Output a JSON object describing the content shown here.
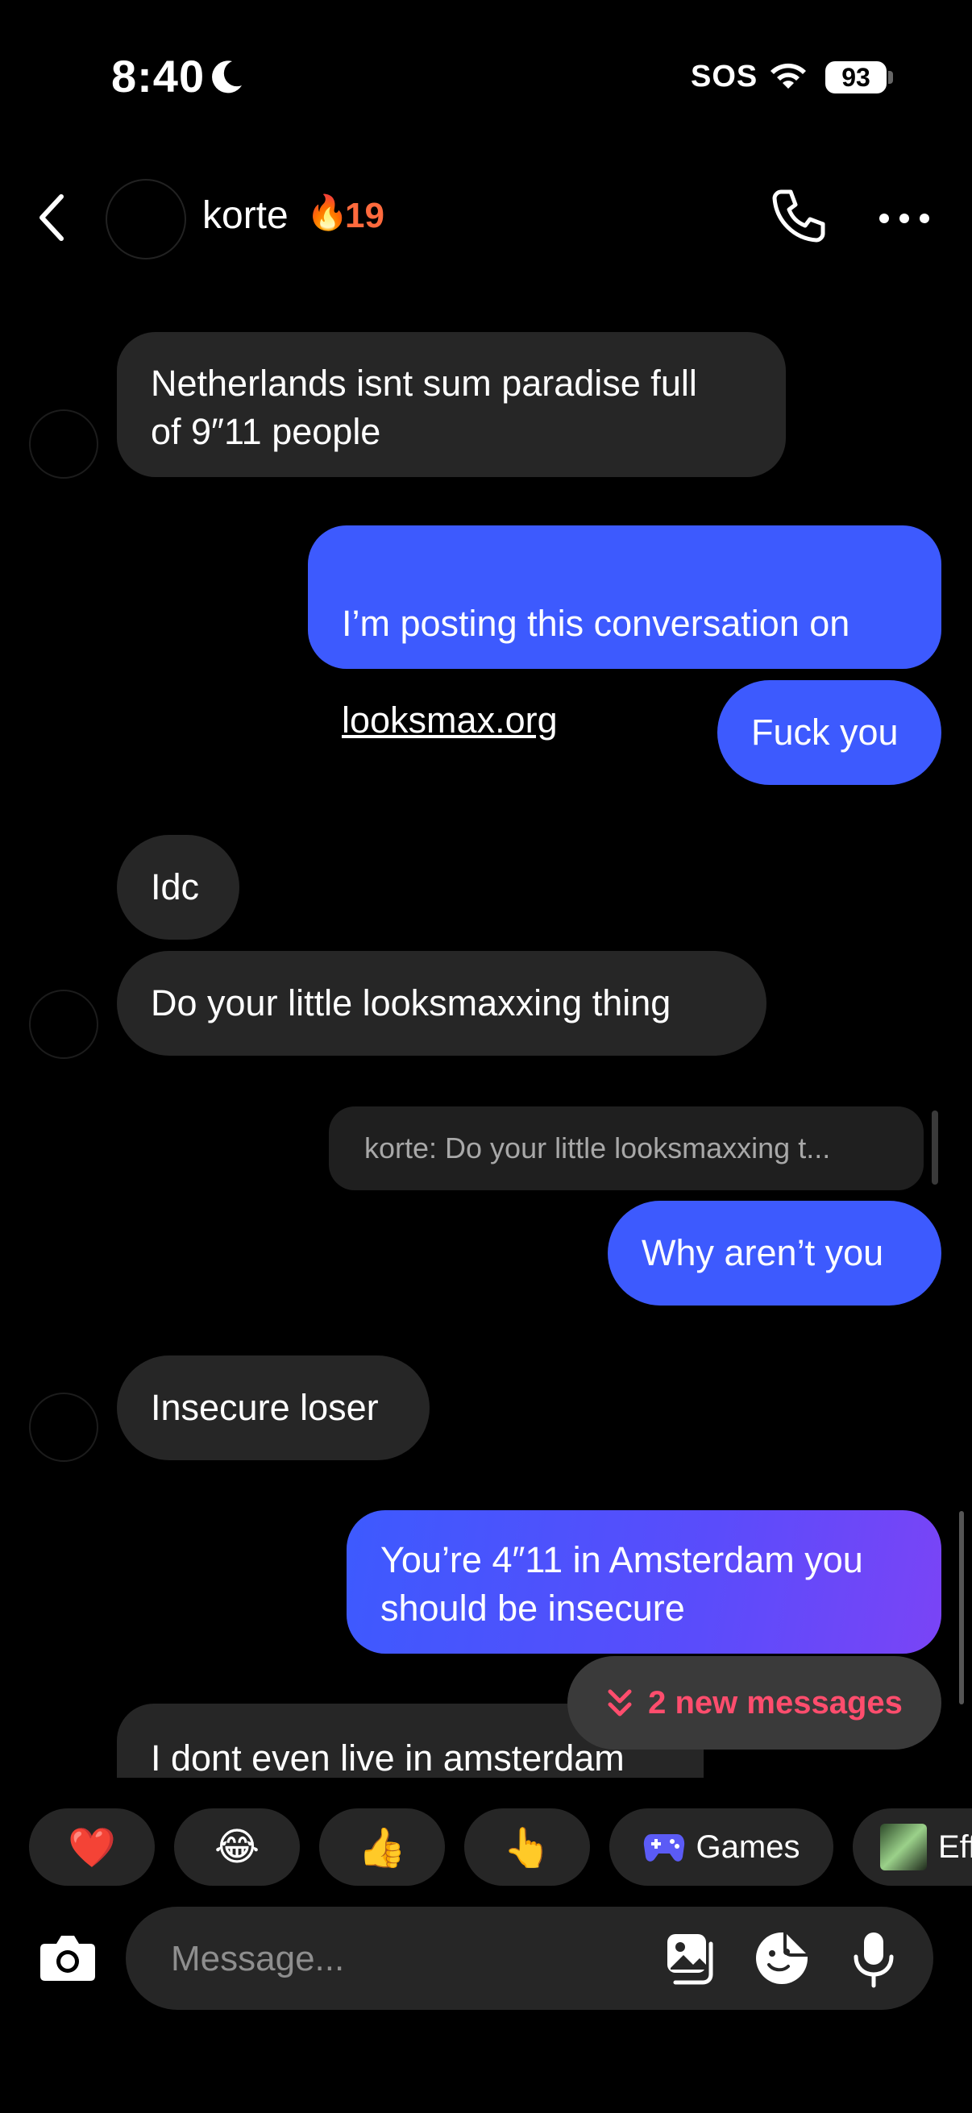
{
  "status_bar": {
    "time": "8:40",
    "sos": "SOS",
    "battery": "93"
  },
  "header": {
    "contact_name": "korte",
    "streak_emoji": "🔥",
    "streak_count": "19"
  },
  "messages": [
    {
      "side": "in",
      "text": "Netherlands isnt sum paradise full\nof 9″11 people"
    },
    {
      "side": "out",
      "text_line1": "I’m posting this conversation on",
      "link": "looksmax.org"
    },
    {
      "side": "out",
      "text": "Fuck you"
    },
    {
      "side": "in",
      "text": "Idc"
    },
    {
      "side": "in",
      "text": "Do your little looksmaxxing thing"
    },
    {
      "side": "out",
      "reply_preview": "korte: Do your little looksmaxxing t...",
      "text": "Why aren’t you"
    },
    {
      "side": "in",
      "text": "Insecure loser"
    },
    {
      "side": "out",
      "text": "You’re 4″11 in Amsterdam you\nshould be insecure"
    },
    {
      "side": "in",
      "text": "I dont even live in amsterdam"
    }
  ],
  "new_messages_pill": "2 new messages",
  "quick_reactions": [
    "❤️",
    "😂",
    "👍",
    "👆"
  ],
  "games_label": "Games",
  "effects_label": "Eff",
  "composer": {
    "placeholder": "Message..."
  },
  "colors": {
    "outgoing_bubble": "#3d5afe",
    "incoming_bubble": "#262626",
    "accent_pink": "#ff4d6d",
    "streak_orange": "#ff6a3d"
  }
}
